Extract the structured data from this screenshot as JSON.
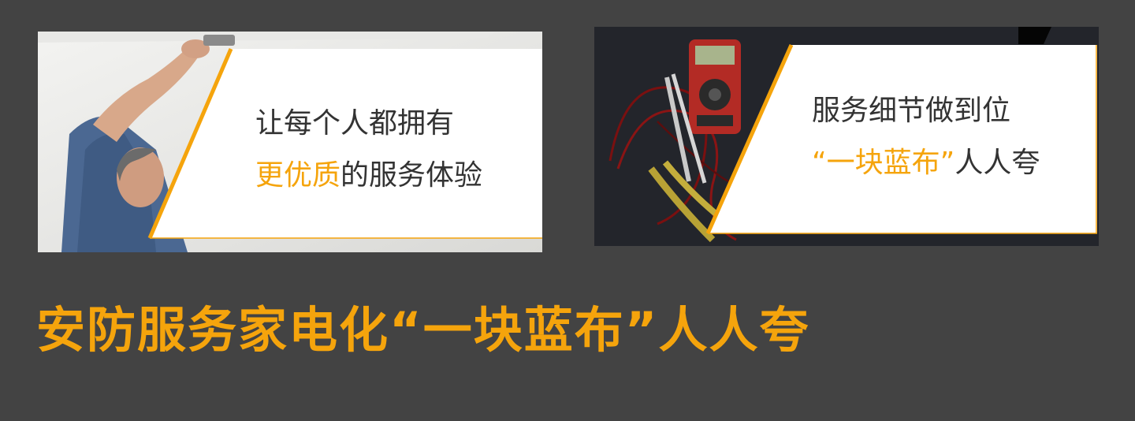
{
  "colors": {
    "background": "#434343",
    "accent": "#f5a40c",
    "panel": "#ffffff",
    "caption_text": "#333333"
  },
  "left_card": {
    "photo": "electrician-ceiling-installation-photo",
    "line1": "让每个人都拥有",
    "line2_highlight": "更优质",
    "line2_rest": "的服务体验"
  },
  "right_card": {
    "photo": "multimeter-and-tools-photo",
    "line1": "服务细节做到位",
    "line2_highlight": "“一块蓝布”",
    "line2_rest": "人人夸"
  },
  "headline": "安防服务家电化“一块蓝布”人人夸"
}
